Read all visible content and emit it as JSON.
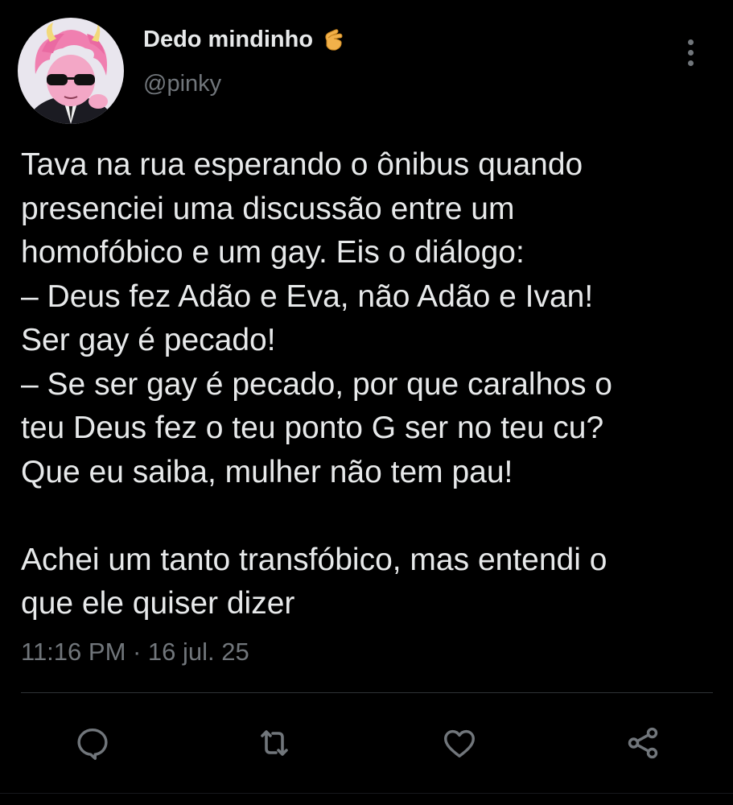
{
  "author": {
    "display_name": "Dedo mindinho",
    "handle": "@pinky",
    "name_emoji": "pinching-hand-icon",
    "avatar": "pink-haired-anime-character-with-sunglasses"
  },
  "tweet": {
    "lines": [
      "Tava na rua esperando o ônibus quando",
      "presenciei uma discussão entre um",
      "homofóbico e um gay. Eis o diálogo:",
      "– Deus fez Adão e Eva, não Adão e Ivan!",
      "Ser gay é pecado!",
      "– Se ser gay é pecado, por que caralhos o",
      "teu Deus fez o teu ponto G ser no teu cu?",
      "Que eu saiba, mulher não tem pau!",
      "",
      "Achei um tanto transfóbico, mas entendi o",
      "que ele quiser dizer"
    ],
    "timestamp": "11:16 PM · 16 jul. 25"
  },
  "actions": {
    "reply": "reply-icon",
    "retweet": "retweet-icon",
    "like": "heart-icon",
    "share": "share-icon"
  },
  "colors": {
    "background": "#000000",
    "primary_text": "#e7e9ea",
    "secondary_text": "#71767b",
    "divider": "#2f3336"
  }
}
